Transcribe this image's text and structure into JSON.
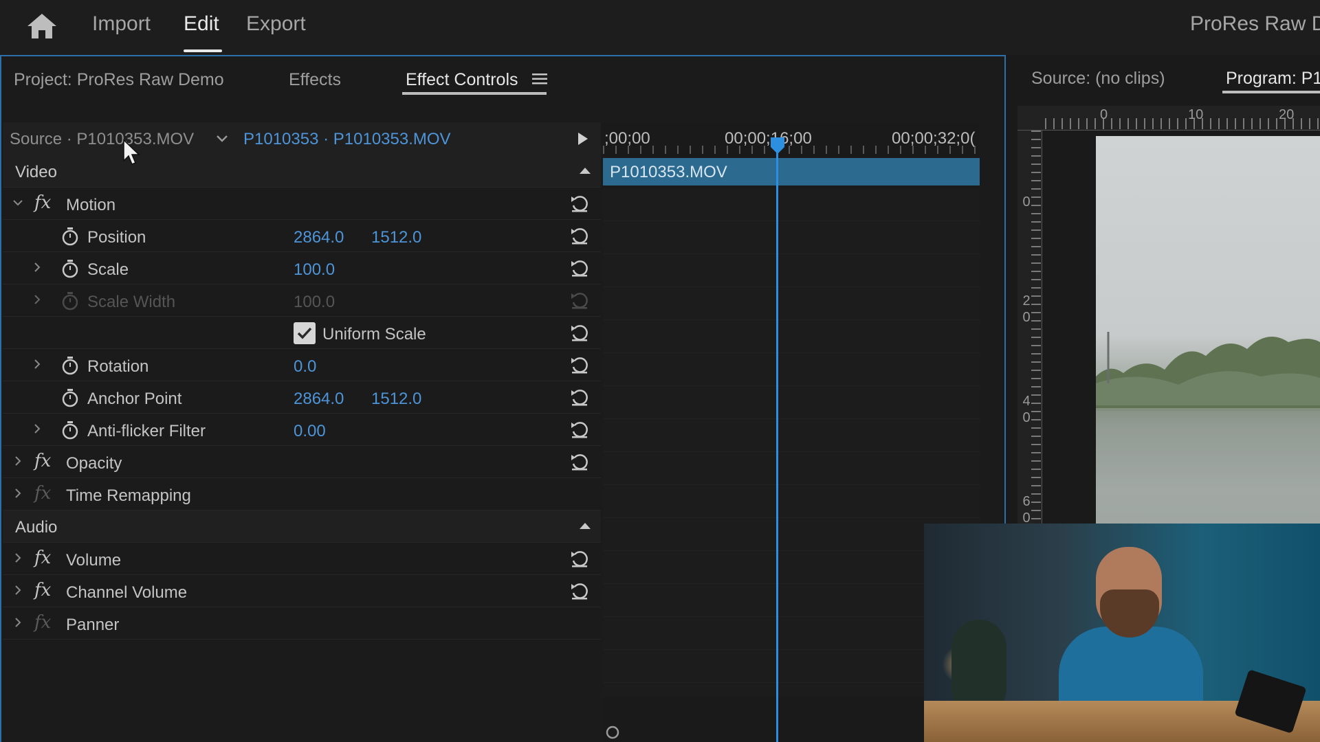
{
  "topbar": {
    "tabs": [
      "Import",
      "Edit",
      "Export"
    ],
    "active_tab": "Edit",
    "project_title": "ProRes Raw De"
  },
  "left_panel": {
    "tabs": [
      "Project: ProRes Raw Demo",
      "Effects",
      "Effect Controls"
    ],
    "active_tab": "Effect Controls",
    "source_label": "Source · P1010353.MOV",
    "clip_label": "P1010353 · P1010353.MOV",
    "sections": {
      "video": "Video",
      "audio": "Audio"
    },
    "effects": {
      "motion": "Motion",
      "opacity": "Opacity",
      "time_remapping": "Time Remapping",
      "volume": "Volume",
      "channel_volume": "Channel Volume",
      "panner": "Panner"
    },
    "props": {
      "position": {
        "label": "Position",
        "x": "2864.0",
        "y": "1512.0"
      },
      "scale": {
        "label": "Scale",
        "value": "100.0"
      },
      "scale_width": {
        "label": "Scale Width",
        "value": "100.0"
      },
      "uniform_scale": {
        "label": "Uniform Scale",
        "checked": true
      },
      "rotation": {
        "label": "Rotation",
        "value": "0.0"
      },
      "anchor_point": {
        "label": "Anchor Point",
        "x": "2864.0",
        "y": "1512.0"
      },
      "anti_flicker": {
        "label": "Anti-flicker Filter",
        "value": "0.00"
      }
    },
    "timeline": {
      "timecodes": [
        ";00;00",
        "00;00;16;00",
        "00;00;32;0("
      ],
      "clip_name": "P1010353.MOV"
    }
  },
  "right_panel": {
    "tabs": [
      "Source: (no clips)",
      "Program: P1"
    ],
    "active_tab": "Program: P1",
    "ruler_top": [
      "0",
      "10",
      "20"
    ],
    "ruler_left": [
      "0",
      "2\n0",
      "4\n0",
      "6\n0"
    ]
  },
  "colors": {
    "accent_blue": "#4d94d8",
    "panel_border": "#2d6fa8",
    "clip_bar": "#2c6a90",
    "playhead": "#2d8fe0"
  }
}
